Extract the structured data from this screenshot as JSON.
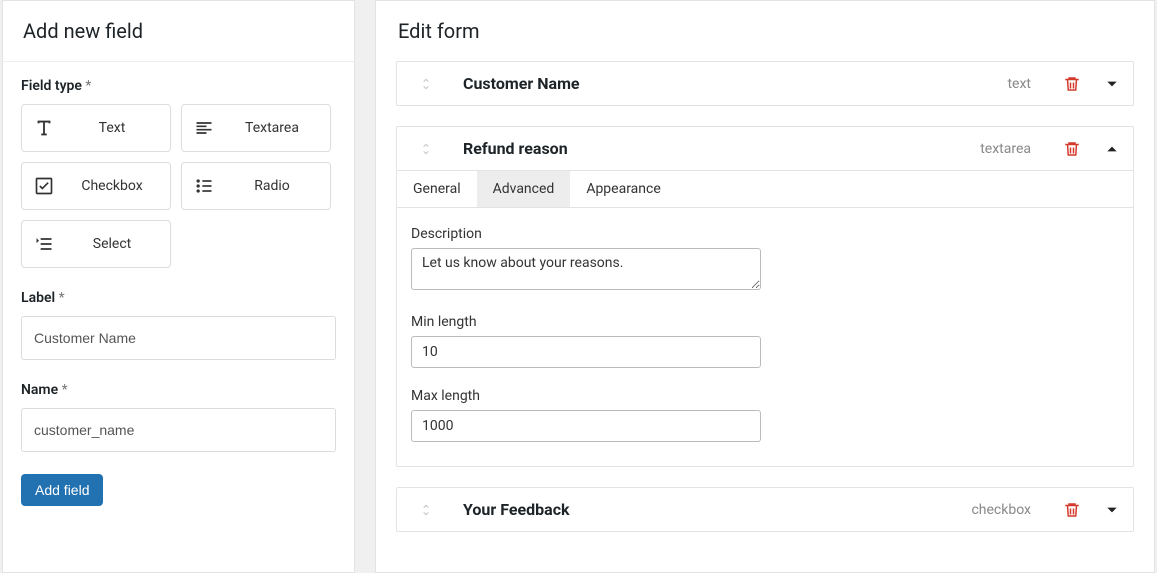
{
  "left": {
    "title": "Add new field",
    "field_type_label": "Field type",
    "req_mark": "*",
    "types": {
      "text": "Text",
      "textarea": "Textarea",
      "checkbox": "Checkbox",
      "radio": "Radio",
      "select": "Select"
    },
    "label_label": "Label",
    "label_value": "Customer Name",
    "name_label": "Name",
    "name_value": "customer_name",
    "add_btn": "Add field"
  },
  "right": {
    "title": "Edit form",
    "fields": [
      {
        "title": "Customer Name",
        "type": "text",
        "expanded": false
      },
      {
        "title": "Refund reason",
        "type": "textarea",
        "expanded": true
      },
      {
        "title": "Your Feedback",
        "type": "checkbox",
        "expanded": false
      }
    ],
    "tabs": {
      "general": "General",
      "advanced": "Advanced",
      "appearance": "Appearance"
    },
    "advanced": {
      "description_label": "Description",
      "description_value": "Let us know about your reasons.",
      "min_label": "Min length",
      "min_value": "10",
      "max_label": "Max length",
      "max_value": "1000"
    }
  }
}
